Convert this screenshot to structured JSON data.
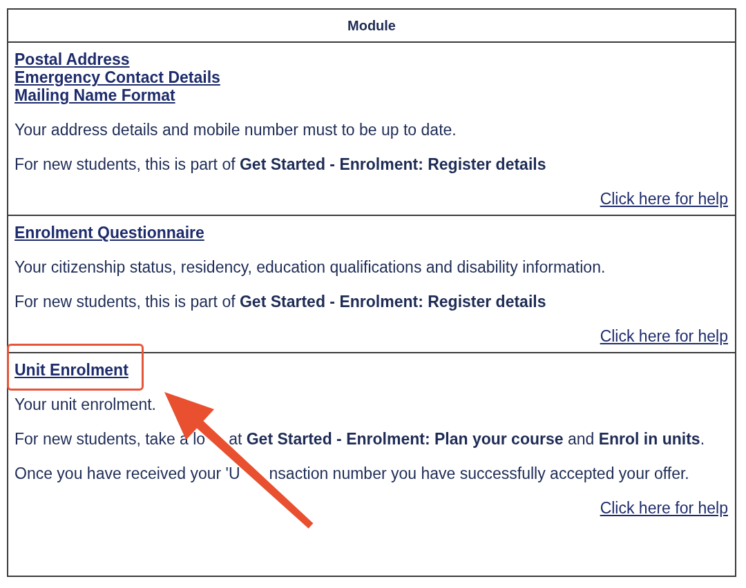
{
  "table": {
    "header": "Module",
    "sections": [
      {
        "links": [
          "Postal Address",
          "Emergency Contact Details",
          "Mailing Name Format"
        ],
        "highlighted": false,
        "paragraphs": [
          {
            "segments": [
              "Your address details and mobile number must to be up to date."
            ]
          },
          {
            "segments": [
              "For new students, this is part of **Get Started - Enrolment: Register details**"
            ]
          }
        ],
        "help": "Click here for help"
      },
      {
        "links": [
          "Enrolment Questionnaire"
        ],
        "highlighted": false,
        "paragraphs": [
          {
            "segments": [
              "Your citizenship status, residency, education qualifications and disability information."
            ]
          },
          {
            "segments": [
              "For new students, this is part of **Get Started - Enrolment: Register details**"
            ]
          }
        ],
        "help": "Click here for help"
      },
      {
        "links": [
          "Unit Enrolment"
        ],
        "highlighted": true,
        "paragraphs": [
          {
            "segments": [
              "Your unit enrolment."
            ]
          },
          {
            "segments": [
              "For new students, take a lo",
              "at **Get Started - Enrolment: Plan your course** and **Enrol in units**."
            ]
          },
          {
            "segments": [
              "Once you have received your 'U",
              "nsaction number you have successfully accepted your offer."
            ]
          }
        ],
        "help": "Click here for help"
      }
    ]
  }
}
